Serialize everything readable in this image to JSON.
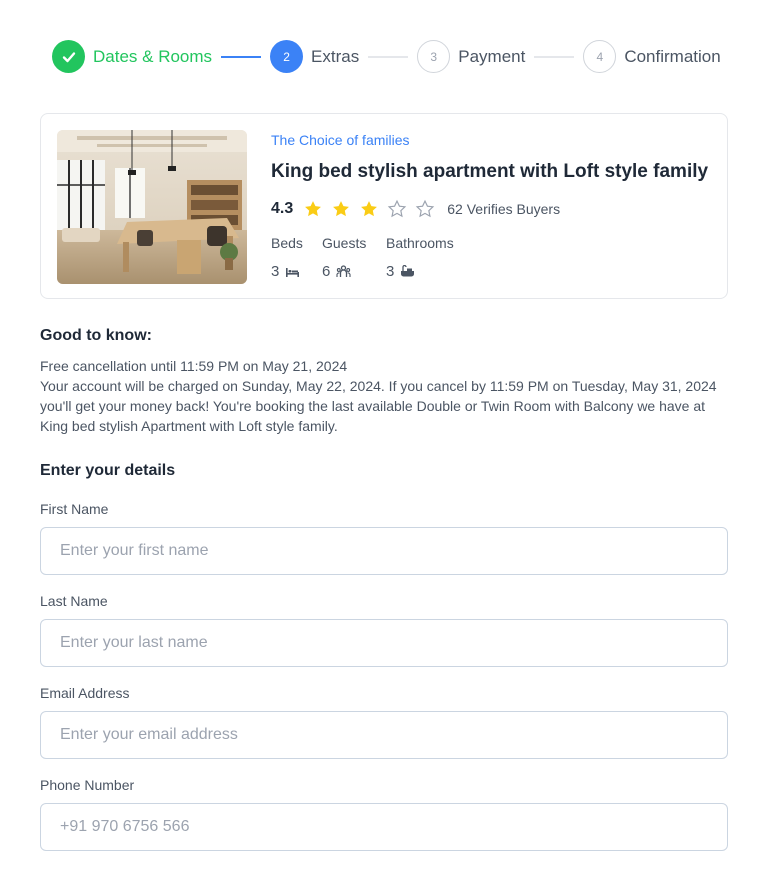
{
  "stepper": {
    "steps": [
      {
        "label": "Dates & Rooms",
        "number": "",
        "state": "done"
      },
      {
        "label": "Extras",
        "number": "2",
        "state": "active"
      },
      {
        "label": "Payment",
        "number": "3",
        "state": "todo"
      },
      {
        "label": "Confirmation",
        "number": "4",
        "state": "todo"
      }
    ]
  },
  "listing": {
    "tagline": "The Choice of families",
    "title": "King bed stylish apartment with Loft style family",
    "rating": "4.3",
    "rating_stars_filled": 3,
    "rating_stars_total": 5,
    "buyers": "62 Verifies Buyers",
    "features": {
      "beds_label": "Beds",
      "guests_label": "Guests",
      "bathrooms_label": "Bathrooms",
      "beds_value": "3",
      "guests_value": "6",
      "bathrooms_value": "3"
    }
  },
  "good_to_know": {
    "title": "Good to know:",
    "line1": "Free cancellation until 11:59 PM on May 21, 2024",
    "line2": "Your account will be charged on Sunday, May 22, 2024. If you cancel by 11:59 PM on Tuesday, May 31, 2024 you'll get your money back! You're booking the last available Double or Twin Room with Balcony we have at King bed stylish Apartment with Loft style family."
  },
  "form": {
    "title": "Enter your details",
    "first_name": {
      "label": "First Name",
      "placeholder": "Enter your first name"
    },
    "last_name": {
      "label": "Last Name",
      "placeholder": "Enter your last name"
    },
    "email": {
      "label": "Email Address",
      "placeholder": "Enter your email address"
    },
    "phone": {
      "label": "Phone Number",
      "placeholder": "+91 970 6756 566"
    }
  },
  "colors": {
    "done": "#22c55e",
    "active": "#3b82f6",
    "star": "#facc15",
    "accent": "#3b82f6"
  },
  "icons": [
    "check-icon",
    "star-icon",
    "bed-icon",
    "guests-icon",
    "bathtub-icon"
  ]
}
